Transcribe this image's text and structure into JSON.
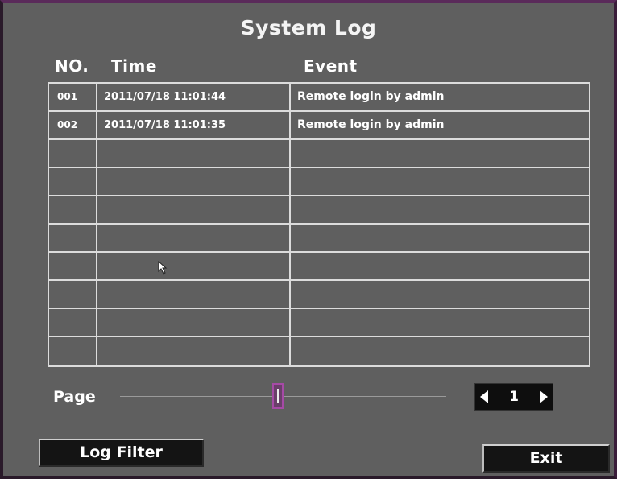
{
  "title": "System Log",
  "columns": {
    "no": "NO.",
    "time": "Time",
    "event": "Event"
  },
  "rows": [
    {
      "no": "001",
      "time": "2011/07/18 11:01:44",
      "event": "Remote login by admin"
    },
    {
      "no": "002",
      "time": "2011/07/18 11:01:35",
      "event": "Remote login by admin"
    },
    {
      "no": "",
      "time": "",
      "event": ""
    },
    {
      "no": "",
      "time": "",
      "event": ""
    },
    {
      "no": "",
      "time": "",
      "event": ""
    },
    {
      "no": "",
      "time": "",
      "event": ""
    },
    {
      "no": "",
      "time": "",
      "event": ""
    },
    {
      "no": "",
      "time": "",
      "event": ""
    },
    {
      "no": "",
      "time": "",
      "event": ""
    },
    {
      "no": "",
      "time": "",
      "event": ""
    }
  ],
  "page": {
    "label": "Page",
    "current": "1"
  },
  "buttons": {
    "log_filter": "Log Filter",
    "exit": "Exit"
  },
  "colors": {
    "background": "#5f5f5f",
    "grid": "#dcdcdc",
    "accent": "#a64aa6"
  }
}
